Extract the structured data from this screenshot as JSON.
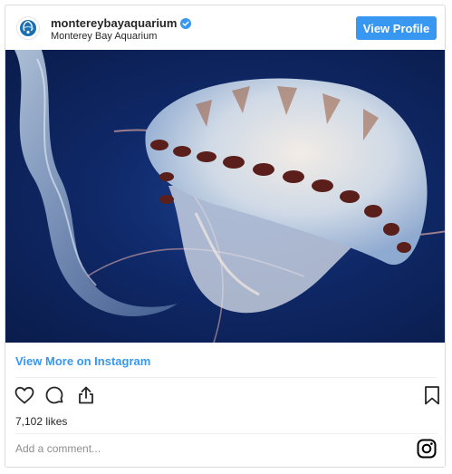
{
  "header": {
    "username": "montereybayaquarium",
    "full_name": "Monterey Bay Aquarium",
    "verified": true,
    "view_profile_label": "View Profile"
  },
  "post": {
    "image_subject": "jellyfish-photo",
    "view_more_label": "View More on Instagram",
    "likes_label": "7,102 likes",
    "comment_placeholder": "Add a comment..."
  },
  "icons": {
    "like": "heart-icon",
    "comment": "comment-icon",
    "share": "share-icon",
    "save": "bookmark-icon",
    "brand": "instagram-icon",
    "avatar": "aquarium-logo-icon",
    "verified": "verified-badge-icon"
  },
  "colors": {
    "accent": "#3897f0",
    "text": "#262626",
    "muted": "#8e8e8e",
    "border": "#dbdbdb"
  }
}
